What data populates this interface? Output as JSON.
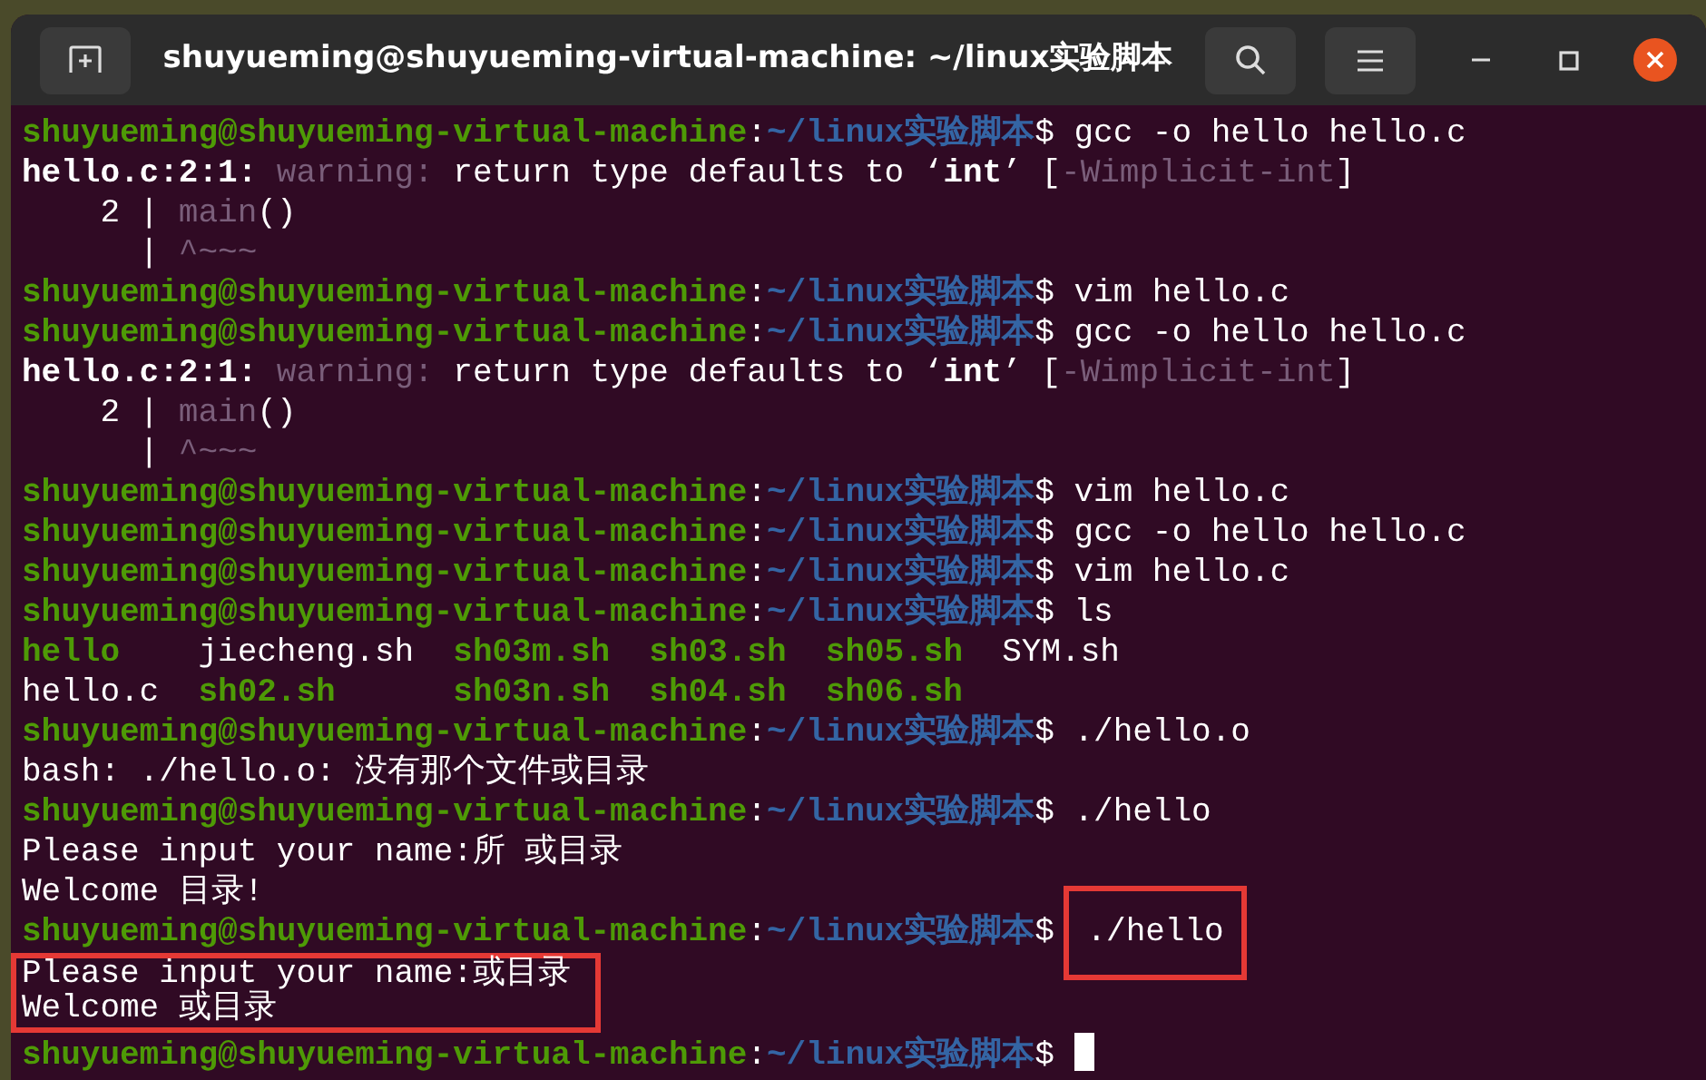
{
  "window": {
    "title": "shuyueming@shuyueming-virtual-machine: ~/linux实验脚本"
  },
  "terminal": {
    "lines": [
      {
        "segments": [
          {
            "kind": "user",
            "text": "shuyueming@shuyueming-virtual-machine"
          },
          {
            "kind": "plain",
            "text": ":"
          },
          {
            "kind": "path",
            "text": "~/linux实验脚本"
          },
          {
            "kind": "plain",
            "text": "$ gcc -o hello hello.c"
          }
        ]
      },
      {
        "segments": [
          {
            "kind": "bold",
            "text": "hello.c:2:1:"
          },
          {
            "kind": "dim",
            "text": " warning:"
          },
          {
            "kind": "plain",
            "text": " return type defaults to ‘"
          },
          {
            "kind": "bold",
            "text": "int"
          },
          {
            "kind": "plain",
            "text": "’ ["
          },
          {
            "kind": "dim",
            "text": "-Wimplicit-int"
          },
          {
            "kind": "plain",
            "text": "]"
          }
        ]
      },
      {
        "segments": [
          {
            "kind": "plain",
            "text": "    2 | "
          },
          {
            "kind": "dim",
            "text": "main"
          },
          {
            "kind": "plain",
            "text": "()"
          }
        ]
      },
      {
        "segments": [
          {
            "kind": "plain",
            "text": "      | "
          },
          {
            "kind": "dim",
            "text": "^~~~"
          }
        ]
      },
      {
        "segments": [
          {
            "kind": "user",
            "text": "shuyueming@shuyueming-virtual-machine"
          },
          {
            "kind": "plain",
            "text": ":"
          },
          {
            "kind": "path",
            "text": "~/linux实验脚本"
          },
          {
            "kind": "plain",
            "text": "$ vim hello.c"
          }
        ]
      },
      {
        "segments": [
          {
            "kind": "user",
            "text": "shuyueming@shuyueming-virtual-machine"
          },
          {
            "kind": "plain",
            "text": ":"
          },
          {
            "kind": "path",
            "text": "~/linux实验脚本"
          },
          {
            "kind": "plain",
            "text": "$ gcc -o hello hello.c"
          }
        ]
      },
      {
        "segments": [
          {
            "kind": "bold",
            "text": "hello.c:2:1:"
          },
          {
            "kind": "dim",
            "text": " warning:"
          },
          {
            "kind": "plain",
            "text": " return type defaults to ‘"
          },
          {
            "kind": "bold",
            "text": "int"
          },
          {
            "kind": "plain",
            "text": "’ ["
          },
          {
            "kind": "dim",
            "text": "-Wimplicit-int"
          },
          {
            "kind": "plain",
            "text": "]"
          }
        ]
      },
      {
        "segments": [
          {
            "kind": "plain",
            "text": "    2 | "
          },
          {
            "kind": "dim",
            "text": "main"
          },
          {
            "kind": "plain",
            "text": "()"
          }
        ]
      },
      {
        "segments": [
          {
            "kind": "plain",
            "text": "      | "
          },
          {
            "kind": "dim",
            "text": "^~~~"
          }
        ]
      },
      {
        "segments": [
          {
            "kind": "user",
            "text": "shuyueming@shuyueming-virtual-machine"
          },
          {
            "kind": "plain",
            "text": ":"
          },
          {
            "kind": "path",
            "text": "~/linux实验脚本"
          },
          {
            "kind": "plain",
            "text": "$ vim hello.c"
          }
        ]
      },
      {
        "segments": [
          {
            "kind": "user",
            "text": "shuyueming@shuyueming-virtual-machine"
          },
          {
            "kind": "plain",
            "text": ":"
          },
          {
            "kind": "path",
            "text": "~/linux实验脚本"
          },
          {
            "kind": "plain",
            "text": "$ gcc -o hello hello.c"
          }
        ]
      },
      {
        "segments": [
          {
            "kind": "user",
            "text": "shuyueming@shuyueming-virtual-machine"
          },
          {
            "kind": "plain",
            "text": ":"
          },
          {
            "kind": "path",
            "text": "~/linux实验脚本"
          },
          {
            "kind": "plain",
            "text": "$ vim hello.c"
          }
        ]
      },
      {
        "segments": [
          {
            "kind": "user",
            "text": "shuyueming@shuyueming-virtual-machine"
          },
          {
            "kind": "plain",
            "text": ":"
          },
          {
            "kind": "path",
            "text": "~/linux实验脚本"
          },
          {
            "kind": "plain",
            "text": "$ ls"
          }
        ]
      },
      {
        "segments": [
          {
            "kind": "exec",
            "text": "hello"
          },
          {
            "kind": "plain",
            "text": "    jiecheng.sh  "
          },
          {
            "kind": "exec",
            "text": "sh03m.sh  sh03.sh  sh05.sh"
          },
          {
            "kind": "plain",
            "text": "  SYM.sh"
          }
        ]
      },
      {
        "segments": [
          {
            "kind": "plain",
            "text": "hello.c  "
          },
          {
            "kind": "exec",
            "text": "sh02.sh      sh03n.sh  sh04.sh  sh06.sh"
          }
        ]
      },
      {
        "segments": [
          {
            "kind": "user",
            "text": "shuyueming@shuyueming-virtual-machine"
          },
          {
            "kind": "plain",
            "text": ":"
          },
          {
            "kind": "path",
            "text": "~/linux实验脚本"
          },
          {
            "kind": "plain",
            "text": "$ ./hello.o"
          }
        ]
      },
      {
        "segments": [
          {
            "kind": "plain",
            "text": "bash: ./hello.o: 没有那个文件或目录"
          }
        ]
      },
      {
        "segments": [
          {
            "kind": "user",
            "text": "shuyueming@shuyueming-virtual-machine"
          },
          {
            "kind": "plain",
            "text": ":"
          },
          {
            "kind": "path",
            "text": "~/linux实验脚本"
          },
          {
            "kind": "plain",
            "text": "$ ./hello"
          }
        ]
      },
      {
        "segments": [
          {
            "kind": "plain",
            "text": "Please input your name:所 或目录"
          }
        ]
      },
      {
        "segments": [
          {
            "kind": "plain",
            "text": "Welcome 目录!"
          }
        ]
      },
      {
        "segments": [
          {
            "kind": "user",
            "text": "shuyueming@shuyueming-virtual-machine"
          },
          {
            "kind": "plain",
            "text": ":"
          },
          {
            "kind": "path",
            "text": "~/linux实验脚本"
          },
          {
            "kind": "plain",
            "text": "$ "
          },
          {
            "kind": "plain",
            "text": "./hello",
            "boxed": true
          }
        ]
      },
      {
        "kind": "boxed",
        "lines": [
          {
            "segments": [
              {
                "kind": "plain",
                "text": "Please input your name:或目录"
              }
            ]
          },
          {
            "segments": [
              {
                "kind": "plain",
                "text": "Welcome 或目录"
              }
            ]
          }
        ]
      },
      {
        "segments": [
          {
            "kind": "user",
            "text": "shuyueming@shuyueming-virtual-machine"
          },
          {
            "kind": "plain",
            "text": ":"
          },
          {
            "kind": "path",
            "text": "~/linux实验脚本"
          },
          {
            "kind": "plain",
            "text": "$ "
          },
          {
            "kind": "cursor"
          }
        ]
      }
    ]
  }
}
